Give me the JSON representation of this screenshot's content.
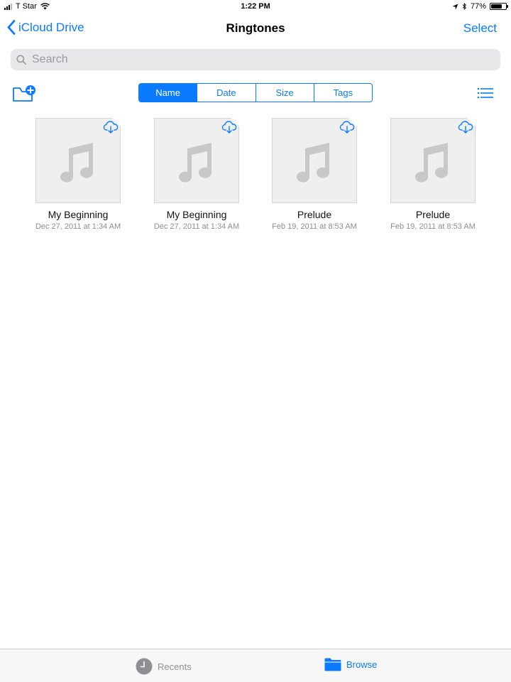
{
  "status_bar": {
    "carrier": "T Star",
    "time": "1:22 PM",
    "battery": "77%",
    "battery_level": 0.77
  },
  "nav": {
    "back_label": "iCloud Drive",
    "title": "Ringtones",
    "select_label": "Select"
  },
  "search": {
    "placeholder": "Search",
    "value": ""
  },
  "sort": {
    "segments": [
      "Name",
      "Date",
      "Size",
      "Tags"
    ],
    "selected": "Name"
  },
  "files": [
    {
      "name": "My Beginning",
      "date": "Dec 27, 2011 at 1:34 AM",
      "icon": "music-note-icon",
      "status_icon": "cloud-download-icon"
    },
    {
      "name": "My Beginning",
      "date": "Dec 27, 2011 at 1:34 AM",
      "icon": "music-note-icon",
      "status_icon": "cloud-download-icon"
    },
    {
      "name": "Prelude",
      "date": "Feb 19, 2011 at 8:53 AM",
      "icon": "music-note-icon",
      "status_icon": "cloud-download-icon"
    },
    {
      "name": "Prelude",
      "date": "Feb 19, 2011 at 8:53 AM",
      "icon": "music-note-icon",
      "status_icon": "cloud-download-icon"
    }
  ],
  "tabs": {
    "recents": "Recents",
    "browse": "Browse",
    "selected": "Browse"
  },
  "colors": {
    "accent": "#0a7aff",
    "thumbnail_bg": "#efefef",
    "music_note": "#c8c8c8",
    "secondary_text": "#8e8e93"
  }
}
